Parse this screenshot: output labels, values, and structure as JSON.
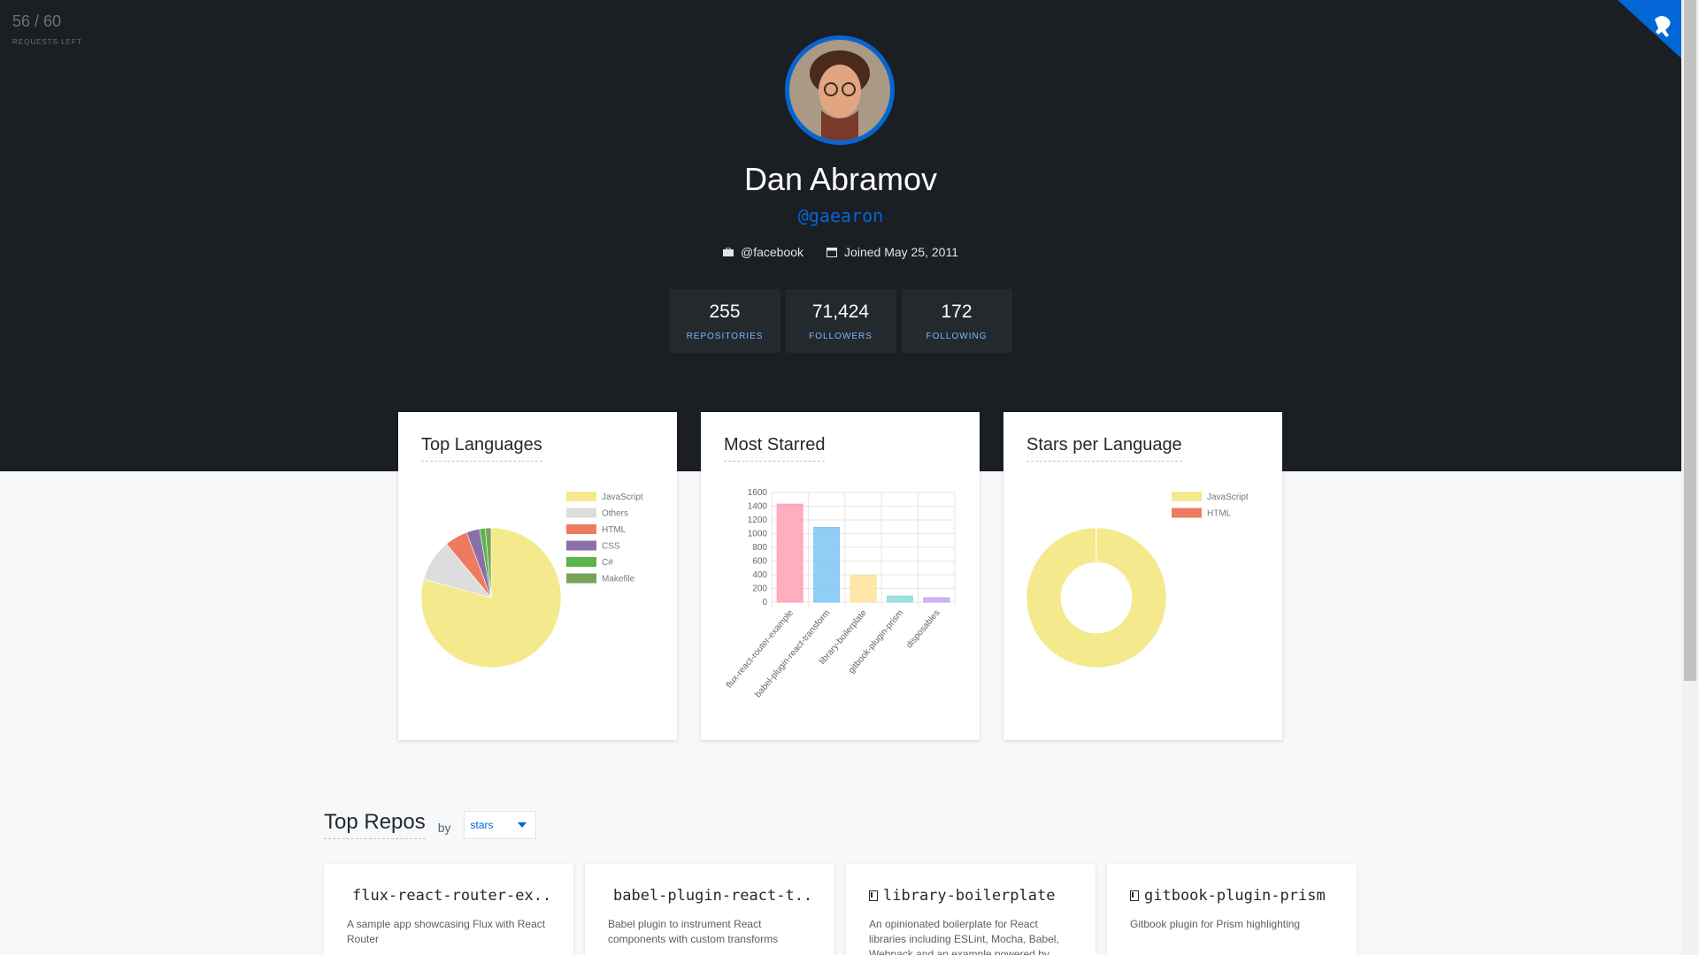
{
  "rate_limit": {
    "count": "56 / 60",
    "label": "REQUESTS LEFT"
  },
  "profile": {
    "name": "Dan Abramov",
    "login": "@gaearon",
    "company": "@facebook",
    "joined": "Joined May 25, 2011"
  },
  "stats": [
    {
      "value": "255",
      "label": "REPOSITORIES"
    },
    {
      "value": "71,424",
      "label": "FOLLOWERS"
    },
    {
      "value": "172",
      "label": "FOLLOWING"
    }
  ],
  "cards": {
    "top_languages": "Top Languages",
    "most_starred": "Most Starred",
    "stars_per_language": "Stars per Language"
  },
  "chart_data": [
    {
      "type": "pie",
      "title": "Top Languages",
      "categories": [
        "JavaScript",
        "Others",
        "HTML",
        "CSS",
        "C#",
        "Makefile"
      ],
      "values": [
        180,
        22,
        12,
        7,
        3,
        3
      ],
      "colors": [
        "#f5e98e",
        "#dddddd",
        "#ec7b60",
        "#8a6fa8",
        "#5bb548",
        "#7aa35a"
      ],
      "legend": "top-right"
    },
    {
      "type": "bar",
      "title": "Most Starred",
      "categories": [
        "flux-react-router-example",
        "babel-plugin-react-transform",
        "library-boilerplate",
        "gitbook-plugin-prism",
        "disposables"
      ],
      "values": [
        1430,
        1090,
        390,
        90,
        65
      ],
      "colors": [
        "#ff9fb4",
        "#7ec5f5",
        "#ffe29a",
        "#8fdcdc",
        "#c8a6f5"
      ],
      "ylim": [
        0,
        1600
      ],
      "yticks": [
        0,
        200,
        400,
        600,
        800,
        1000,
        1200,
        1400,
        1600
      ],
      "grid": true
    },
    {
      "type": "pie",
      "subtype": "doughnut",
      "title": "Stars per Language",
      "categories": [
        "JavaScript",
        "HTML"
      ],
      "values": [
        3330,
        4
      ],
      "colors": [
        "#f5e98e",
        "#ec7b60"
      ],
      "legend": "top-right"
    }
  ],
  "top_repos": {
    "title": "Top Repos",
    "by": "by",
    "sort_value": "stars",
    "repos": [
      {
        "name": "flux-react-router-ex...",
        "desc": "A sample app showcasing Flux with React Router"
      },
      {
        "name": "babel-plugin-react-t...",
        "desc": "Babel plugin to instrument React components with custom transforms"
      },
      {
        "name": "library-boilerplate",
        "desc": "An opinionated boilerplate for React libraries including ESLint, Mocha, Babel, Webpack and an example powered by"
      },
      {
        "name": "gitbook-plugin-prism",
        "desc": "Gitbook plugin for Prism highlighting"
      }
    ]
  }
}
